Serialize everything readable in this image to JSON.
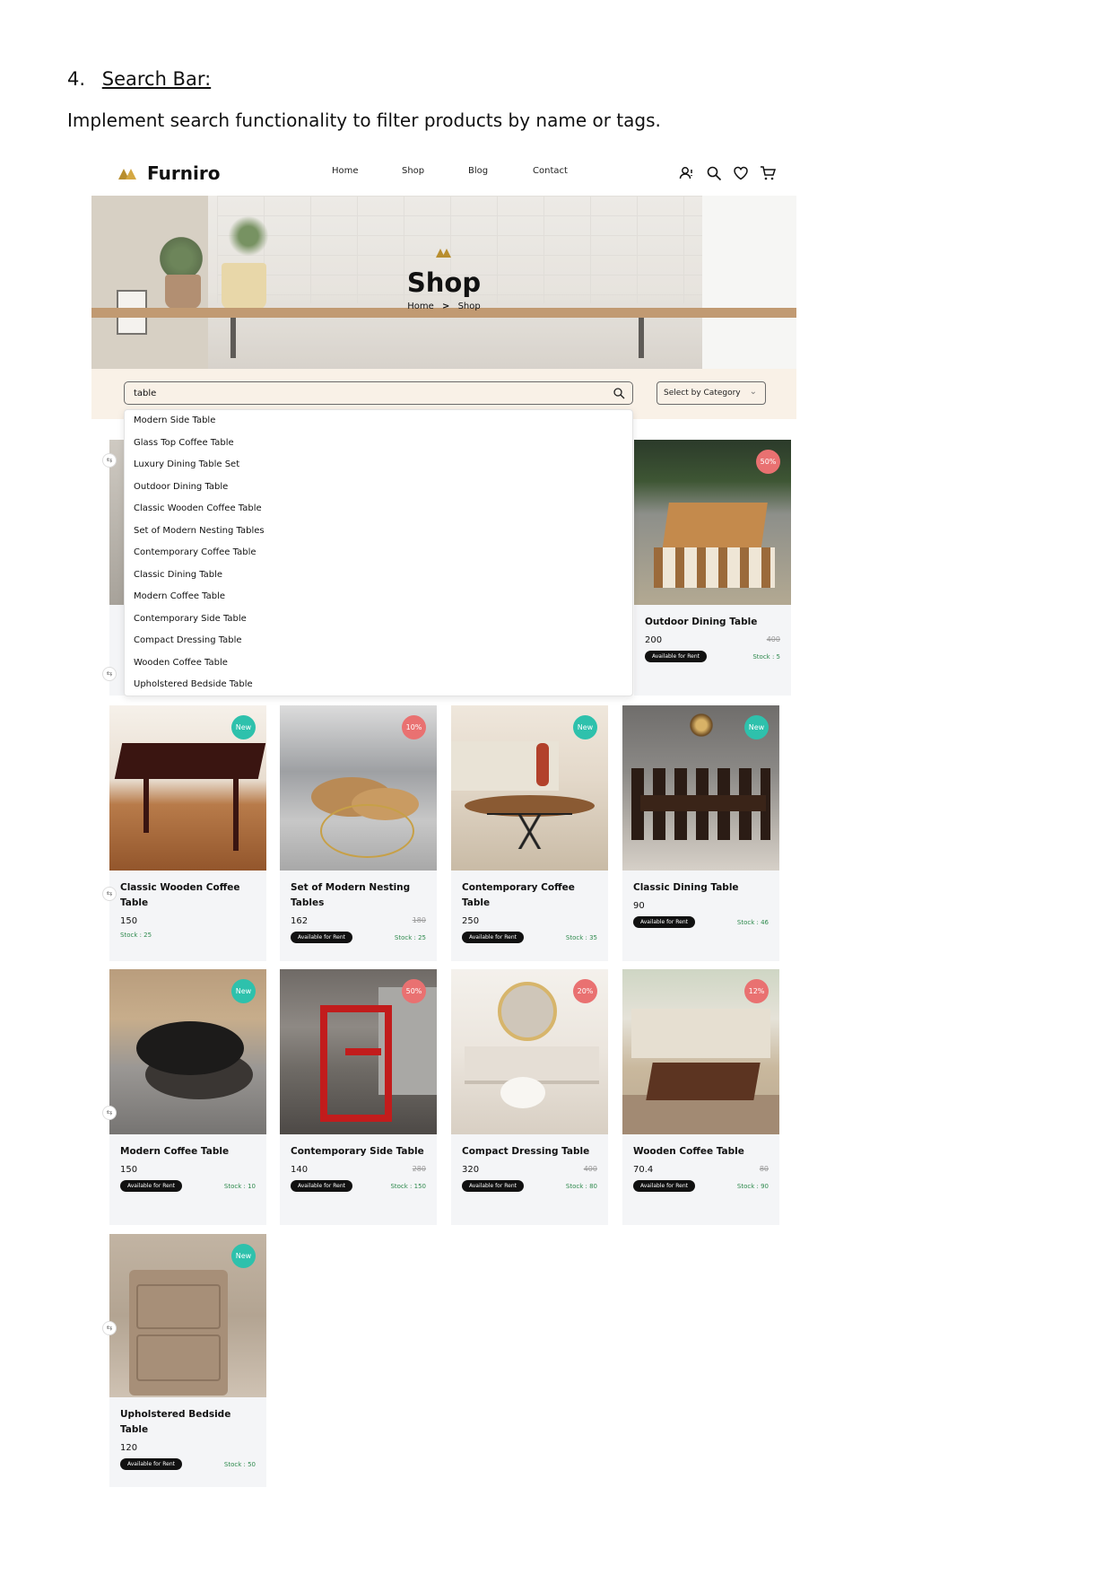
{
  "doc": {
    "number": "4.",
    "title": "Search Bar:",
    "description": "Implement search functionality to filter products by name or tags."
  },
  "nav": {
    "brand": "Furniro",
    "links": [
      "Home",
      "Shop",
      "Blog",
      "Contact"
    ],
    "icons": [
      "account-icon",
      "search-icon",
      "heart-icon",
      "cart-icon"
    ]
  },
  "hero": {
    "title": "Shop",
    "breadcrumb": {
      "home": "Home",
      "separator": ">",
      "current": "Shop"
    }
  },
  "search": {
    "value": "table",
    "category_placeholder": "Select by Category"
  },
  "suggestions": [
    "Modern Side Table",
    "Glass Top Coffee Table",
    "Luxury Dining Table Set",
    "Outdoor Dining Table",
    "Classic Wooden Coffee Table",
    "Set of Modern Nesting Tables",
    "Contemporary Coffee Table",
    "Classic Dining Table",
    "Modern Coffee Table",
    "Contemporary Side Table",
    "Compact Dressing Table",
    "Wooden Coffee Table",
    "Upholstered Bedside Table"
  ],
  "products": [
    {
      "name": "Outdoor Dining Table",
      "price": "200",
      "old_price": "400",
      "badge": "50%",
      "rent": "Available for Rent",
      "stock": "Stock : 5"
    },
    {
      "name": "Classic Wooden Coffee Table",
      "price": "150",
      "old_price": "",
      "badge": "New",
      "rent": "",
      "stock": "Stock : 25"
    },
    {
      "name": "Set of Modern Nesting Tables",
      "price": "162",
      "old_price": "180",
      "badge": "10%",
      "rent": "Available for Rent",
      "stock": "Stock : 25"
    },
    {
      "name": "Contemporary Coffee Table",
      "price": "250",
      "old_price": "",
      "badge": "New",
      "rent": "Available for Rent",
      "stock": "Stock : 35"
    },
    {
      "name": "Classic Dining Table",
      "price": "90",
      "old_price": "",
      "badge": "New",
      "rent": "Available for Rent",
      "stock": "Stock : 46"
    },
    {
      "name": "Modern Coffee Table",
      "price": "150",
      "old_price": "",
      "badge": "New",
      "rent": "Available for Rent",
      "stock": "Stock : 10"
    },
    {
      "name": "Contemporary Side Table",
      "price": "140",
      "old_price": "280",
      "badge": "50%",
      "rent": "Available for Rent",
      "stock": "Stock : 150"
    },
    {
      "name": "Compact Dressing Table",
      "price": "320",
      "old_price": "400",
      "badge": "20%",
      "rent": "Available for Rent",
      "stock": "Stock : 80"
    },
    {
      "name": "Wooden Coffee Table",
      "price": "70.4",
      "old_price": "80",
      "badge": "12%",
      "rent": "Available for Rent",
      "stock": "Stock : 90"
    },
    {
      "name": "Upholstered Bedside Table",
      "price": "120",
      "old_price": "",
      "badge": "New",
      "rent": "Available for Rent",
      "stock": "Stock : 50"
    }
  ],
  "colors": {
    "accent": "#b88e2f",
    "new_badge": "#2ec1ac",
    "sale_badge": "#e97171",
    "band": "#f9f1e7",
    "stock_text": "#2f8a4e"
  }
}
